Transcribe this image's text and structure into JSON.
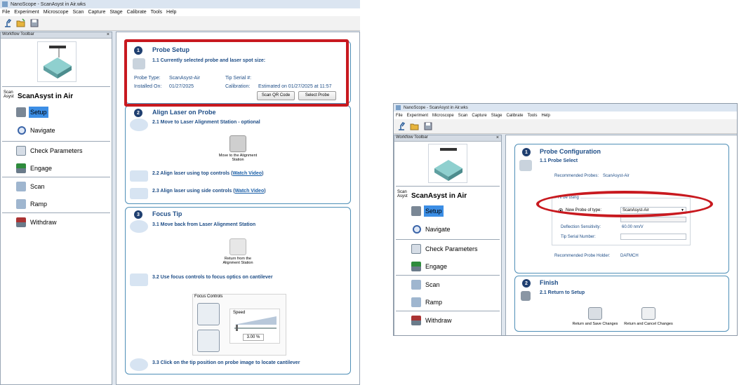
{
  "left": {
    "title": "NanoScope - ScanAsyst in Air.wks",
    "menu": [
      "File",
      "Experiment",
      "Microscope",
      "Scan",
      "Capture",
      "Stage",
      "Calibrate",
      "Tools",
      "Help"
    ],
    "workflow_toolbar": "Workflow Toolbar",
    "close_glyph": "×",
    "mode_logo": "Scan Asyst",
    "mode_name": "ScanAsyst in Air",
    "steps": [
      "Setup",
      "Navigate",
      "Check Parameters",
      "Engage",
      "Scan",
      "Ramp",
      "Withdraw"
    ],
    "card1": {
      "num": "1",
      "title": "Probe Setup",
      "sub": "1.1 Currently selected probe and laser spot size:",
      "probe_type_label": "Probe Type:",
      "probe_type_value": "ScanAsyst-Air",
      "tip_serial_label": "Tip Serial #:",
      "installed_label": "Installed On:",
      "installed_value": "01/27/2025",
      "calibration_label": "Calibration:",
      "calibration_value": "Estimated on 01/27/2025 at 11:57",
      "btn_scan_qr": "Scan QR Code",
      "btn_select_probe": "Select Probe"
    },
    "card2": {
      "num": "2",
      "title": "Align Laser on Probe",
      "sub1": "2.1 Move to Laser Alignment Station - optional",
      "move_btn": "Move to the Alignment Station",
      "sub2_prefix": "2.2 Align laser using top controls (",
      "sub3_prefix": "2.3 Align laser using side controls (",
      "watch_video": "Watch Video",
      "close_paren": ")"
    },
    "card3": {
      "num": "3",
      "title": "Focus Tip",
      "sub1": "3.1 Move back from Laser Alignment Station",
      "return_btn": "Return from the Alignment Station",
      "sub2": "3.2 Use focus controls to focus optics on cantilever",
      "focus_controls": "Focus Controls",
      "speed": "Speed",
      "speed_value": "3.00 %",
      "sub3": "3.3 Click on the tip position on probe image to locate cantilever"
    }
  },
  "right": {
    "title": "NanoScope - ScanAsyst in Air.wks",
    "menu": [
      "File",
      "Experiment",
      "Microscope",
      "Scan",
      "Capture",
      "Stage",
      "Calibrate",
      "Tools",
      "Help"
    ],
    "workflow_toolbar": "Workflow Toolbar",
    "close_glyph": "×",
    "mode_logo": "Scan Asyst",
    "mode_name": "ScanAsyst in Air",
    "steps": [
      "Setup",
      "Navigate",
      "Check Parameters",
      "Engage",
      "Scan",
      "Ramp",
      "Withdraw"
    ],
    "card1": {
      "num": "1",
      "title": "Probe Configuration",
      "sub": "1.1 Probe Select",
      "recommended_probes_label": "Recommended Probes:",
      "recommended_probes_value": "ScanAsyst-Air",
      "will_be_using": "I'll be using",
      "new_probe_label": "New Probe of type:",
      "new_probe_value": "ScanAsyst-Air",
      "deflection_label": "Deflection Sensitivity:",
      "deflection_value": "60.00 nm/V",
      "tip_serial_label": "Tip Serial Number:",
      "holder_label": "Recommended Probe Holder:",
      "holder_value": "DAFMCH"
    },
    "card2": {
      "num": "2",
      "title": "Finish",
      "sub": "2.1 Return to Setup",
      "btn_save": "Return and Save Changes",
      "btn_cancel": "Return and Cancel Changes"
    }
  },
  "colors": {
    "accent": "#1f4e87",
    "highlight": "#c8191f",
    "select": "#3c8ee5"
  }
}
